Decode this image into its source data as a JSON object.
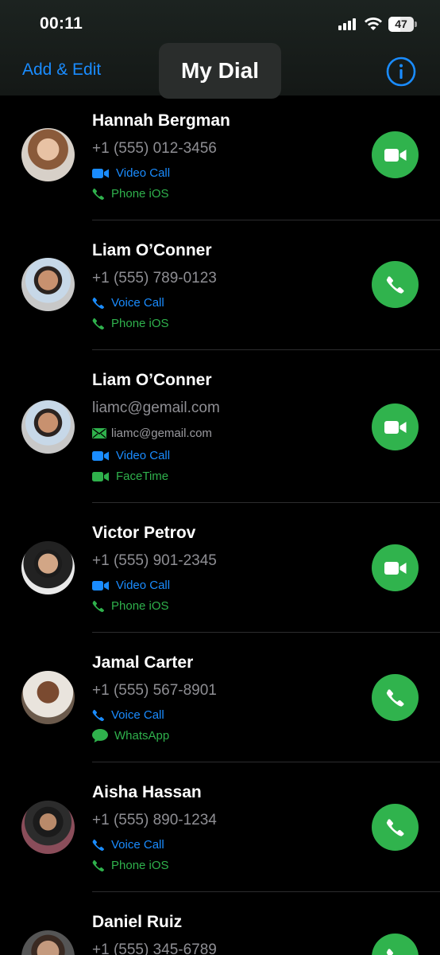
{
  "status_bar": {
    "time": "00:11",
    "battery": "47"
  },
  "nav": {
    "left_label": "Add & Edit",
    "title": "My Dial"
  },
  "contacts": [
    {
      "name": "Hannah Bergman",
      "number": "+1 (555) 012-3456",
      "line1": "Video Call",
      "line2": "Phone iOS"
    },
    {
      "name": "Liam O’Conner",
      "number": "+1 (555) 789-0123",
      "line1": "Voice Call",
      "line2": "Phone iOS"
    },
    {
      "name": "Liam O’Conner",
      "number": "liamc@gemail.com",
      "email": "liamc@gemail.com",
      "line1": "Video Call",
      "line2": "FaceTime"
    },
    {
      "name": "Victor Petrov",
      "number": "+1 (555) 901-2345",
      "line1": "Video Call",
      "line2": "Phone iOS"
    },
    {
      "name": "Jamal Carter",
      "number": "+1 (555) 567-8901",
      "line1": "Voice Call",
      "line2": "WhatsApp"
    },
    {
      "name": "Aisha Hassan",
      "number": "+1 (555) 890-1234",
      "line1": "Voice Call",
      "line2": "Phone iOS"
    },
    {
      "name": "Daniel Ruiz",
      "number": "+1 (555) 345-6789"
    }
  ],
  "colors": {
    "accent_blue": "#1a8cff",
    "call_green": "#30b34d",
    "background": "#000000"
  }
}
